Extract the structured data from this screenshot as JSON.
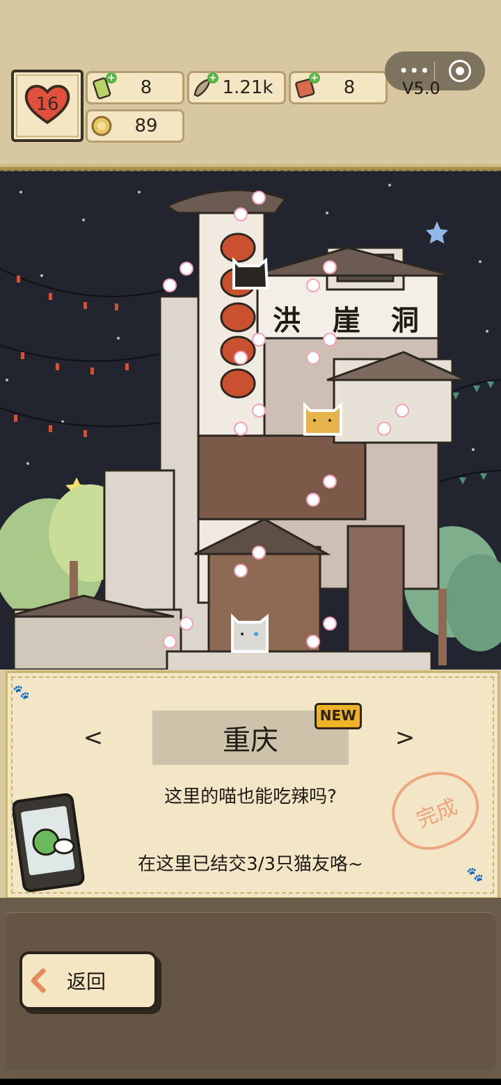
{
  "resources": {
    "hearts": "16",
    "cat_food": "8",
    "fish": "1.21k",
    "cans": "8",
    "coins": "89"
  },
  "capsule": {
    "menu_icon": "more-dots-icon",
    "close_icon": "target-icon",
    "version": "V5.0"
  },
  "scene": {
    "sign_chars": [
      "洪",
      "崖",
      "洞"
    ]
  },
  "panel": {
    "prev": "<",
    "next": ">",
    "city": "重庆",
    "badge": "NEW",
    "question": "这里的喵也能吃辣吗?",
    "friends": "在这里已结交3/3只猫友咯~",
    "stamp": "完成"
  },
  "footer": {
    "back_label": "返回"
  },
  "colors": {
    "accent": "#e58b5f",
    "badge": "#f0b227",
    "panel": "#f3e6c7"
  }
}
